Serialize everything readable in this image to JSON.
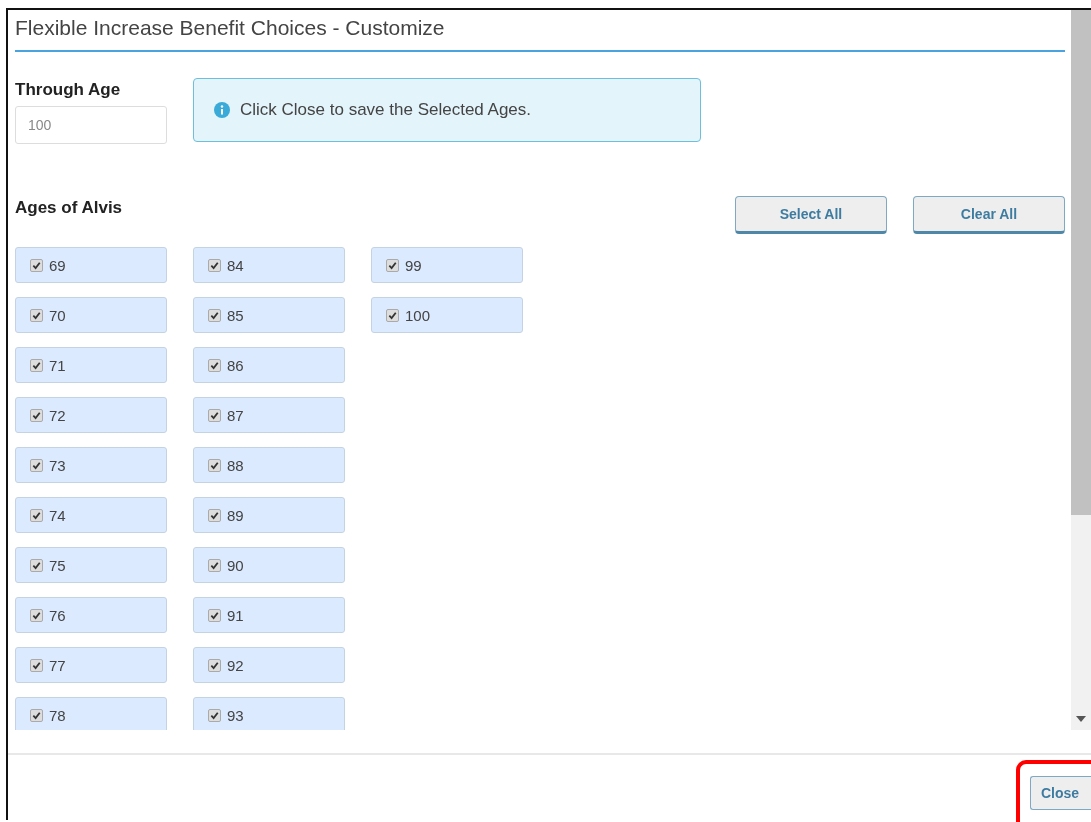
{
  "dialog": {
    "title": "Flexible Increase Benefit Choices - Customize"
  },
  "through_age": {
    "label": "Through Age",
    "placeholder": "100"
  },
  "alert": {
    "text": "Click Close to save the Selected Ages."
  },
  "ages_heading": "Ages of Alvis",
  "buttons": [
    "Select All",
    "Clear All"
  ],
  "age_columns": [
    {
      "ages": [
        {
          "label": "69",
          "checked": true
        },
        {
          "label": "70",
          "checked": true
        },
        {
          "label": "71",
          "checked": true
        },
        {
          "label": "72",
          "checked": true
        },
        {
          "label": "73",
          "checked": true
        },
        {
          "label": "74",
          "checked": true
        },
        {
          "label": "75",
          "checked": true
        },
        {
          "label": "76",
          "checked": true
        },
        {
          "label": "77",
          "checked": true
        },
        {
          "label": "78",
          "checked": true
        }
      ]
    },
    {
      "ages": [
        {
          "label": "84",
          "checked": true
        },
        {
          "label": "85",
          "checked": true
        },
        {
          "label": "86",
          "checked": true
        },
        {
          "label": "87",
          "checked": true
        },
        {
          "label": "88",
          "checked": true
        },
        {
          "label": "89",
          "checked": true
        },
        {
          "label": "90",
          "checked": true
        },
        {
          "label": "91",
          "checked": true
        },
        {
          "label": "92",
          "checked": true
        },
        {
          "label": "93",
          "checked": true
        }
      ]
    },
    {
      "ages": [
        {
          "label": "99",
          "checked": true
        },
        {
          "label": "100",
          "checked": true
        }
      ]
    }
  ],
  "footer": {
    "close_button": "Close",
    "highlighted": true
  }
}
